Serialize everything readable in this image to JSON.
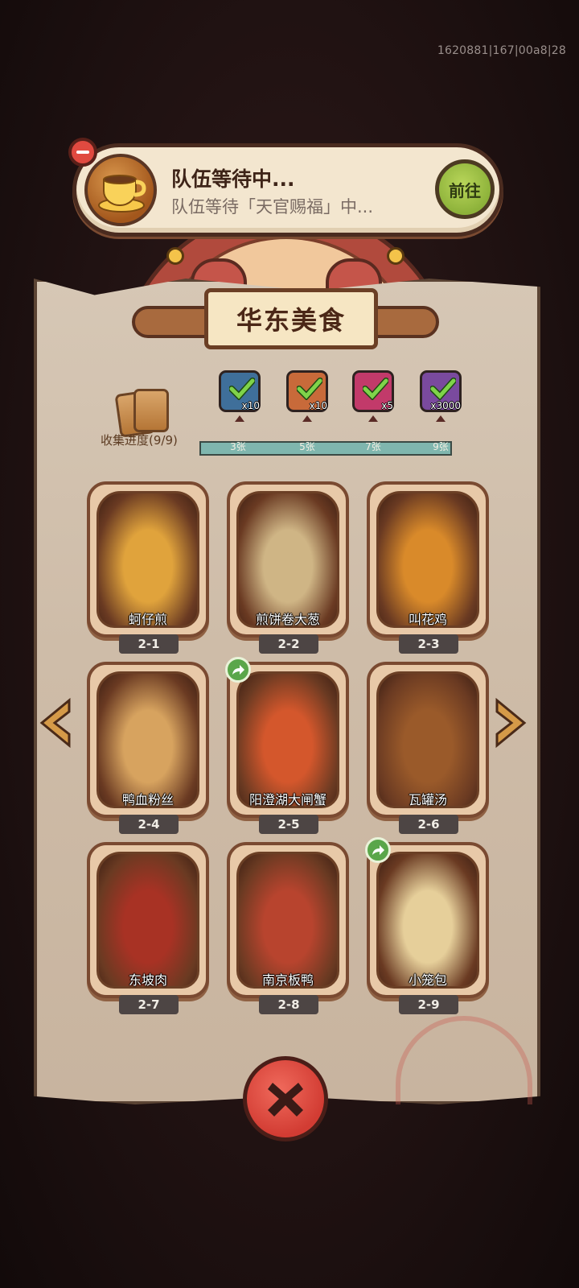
{
  "device_id": "1620881|167|00a8|28",
  "banner": {
    "title": "队伍等待中...",
    "subtitle": "队伍等待「天官赐福」中...",
    "go_label": "前往",
    "icon": "coffee-cup-icon"
  },
  "page_title": "华东美食",
  "collection": {
    "label": "收集进度(9/9)",
    "progress": 1.0,
    "milestones": [
      {
        "label": "3张",
        "qty": "x10",
        "icon": "chest-icon",
        "color": "#3f6f9a",
        "claimed": true
      },
      {
        "label": "5张",
        "qty": "x10",
        "icon": "key-icon",
        "color": "#c86a3a",
        "claimed": true
      },
      {
        "label": "7张",
        "qty": "x5",
        "icon": "gem-icon",
        "color": "#c23a6a",
        "claimed": true
      },
      {
        "label": "9张",
        "qty": "x3000",
        "icon": "crystal-icon",
        "color": "#7a4a9e",
        "claimed": true
      }
    ]
  },
  "dishes": [
    {
      "name": "蚵仔煎",
      "code": "2-1",
      "color": "#e0a33c",
      "shared": false
    },
    {
      "name": "煎饼卷大葱",
      "code": "2-2",
      "color": "#cfb585",
      "shared": false
    },
    {
      "name": "叫花鸡",
      "code": "2-3",
      "color": "#d98a2a",
      "shared": false
    },
    {
      "name": "鸭血粉丝",
      "code": "2-4",
      "color": "#d7a35f",
      "shared": false
    },
    {
      "name": "阳澄湖大闸蟹",
      "code": "2-5",
      "color": "#d4572c",
      "shared": true
    },
    {
      "name": "瓦罐汤",
      "code": "2-6",
      "color": "#9a5a2a",
      "shared": false
    },
    {
      "name": "东坡肉",
      "code": "2-7",
      "color": "#a83224",
      "shared": false
    },
    {
      "name": "南京板鸭",
      "code": "2-8",
      "color": "#b8442e",
      "shared": false
    },
    {
      "name": "小笼包",
      "code": "2-9",
      "color": "#e6cf9a",
      "shared": true
    }
  ],
  "close_icon": "close-x-icon"
}
